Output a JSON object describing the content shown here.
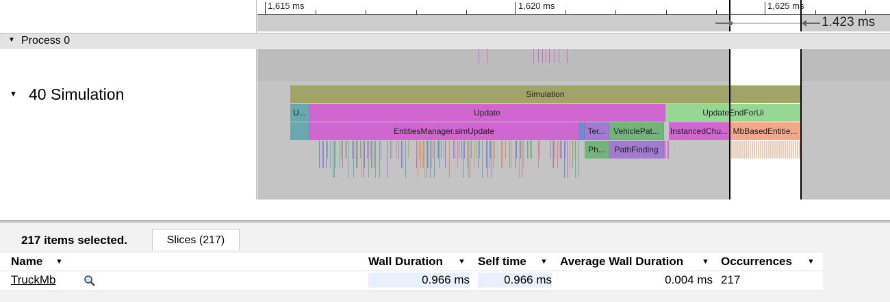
{
  "ruler": {
    "labels": [
      "1,615 ms",
      "1,620 ms",
      "1,625 ms"
    ],
    "selection_duration": "1.423 ms"
  },
  "process": {
    "label": "Process 0"
  },
  "thread": {
    "label": "40 Simulation"
  },
  "slices": {
    "simulation": "Simulation",
    "u_short": "U...",
    "update": "Update",
    "update_end_for_ui": "UpdateEndForUi",
    "entities_manager": "EntitiesManager.simUpdate",
    "ter": "Ter...",
    "vehicle_path": "VehiclePat...",
    "instanced_chunk": "InstancedChu...",
    "mb_based": "MbBasedEntitie...",
    "ph": "Ph...",
    "path_finding": "PathFinding"
  },
  "colors": {
    "simulation": "#a0a468",
    "update": "#d066d0",
    "update_end": "#94d894",
    "mb_based": "#f3a88c",
    "teal": "#6aa8b0",
    "path_finding": "#a27bd0",
    "vehicle_path": "#74b47c"
  },
  "analysis": {
    "selection_label": "217 items selected.",
    "tab_label": "Slices (217)",
    "columns": {
      "name": "Name",
      "wall_duration": "Wall Duration",
      "self_time": "Self time",
      "avg_wall_duration": "Average Wall Duration",
      "occurrences": "Occurrences"
    },
    "rows": [
      {
        "name": "TruckMb",
        "wall_duration": "0.966 ms",
        "self_time": "0.966 ms",
        "avg_wall_duration": "0.004 ms",
        "occurrences": "217"
      }
    ]
  }
}
